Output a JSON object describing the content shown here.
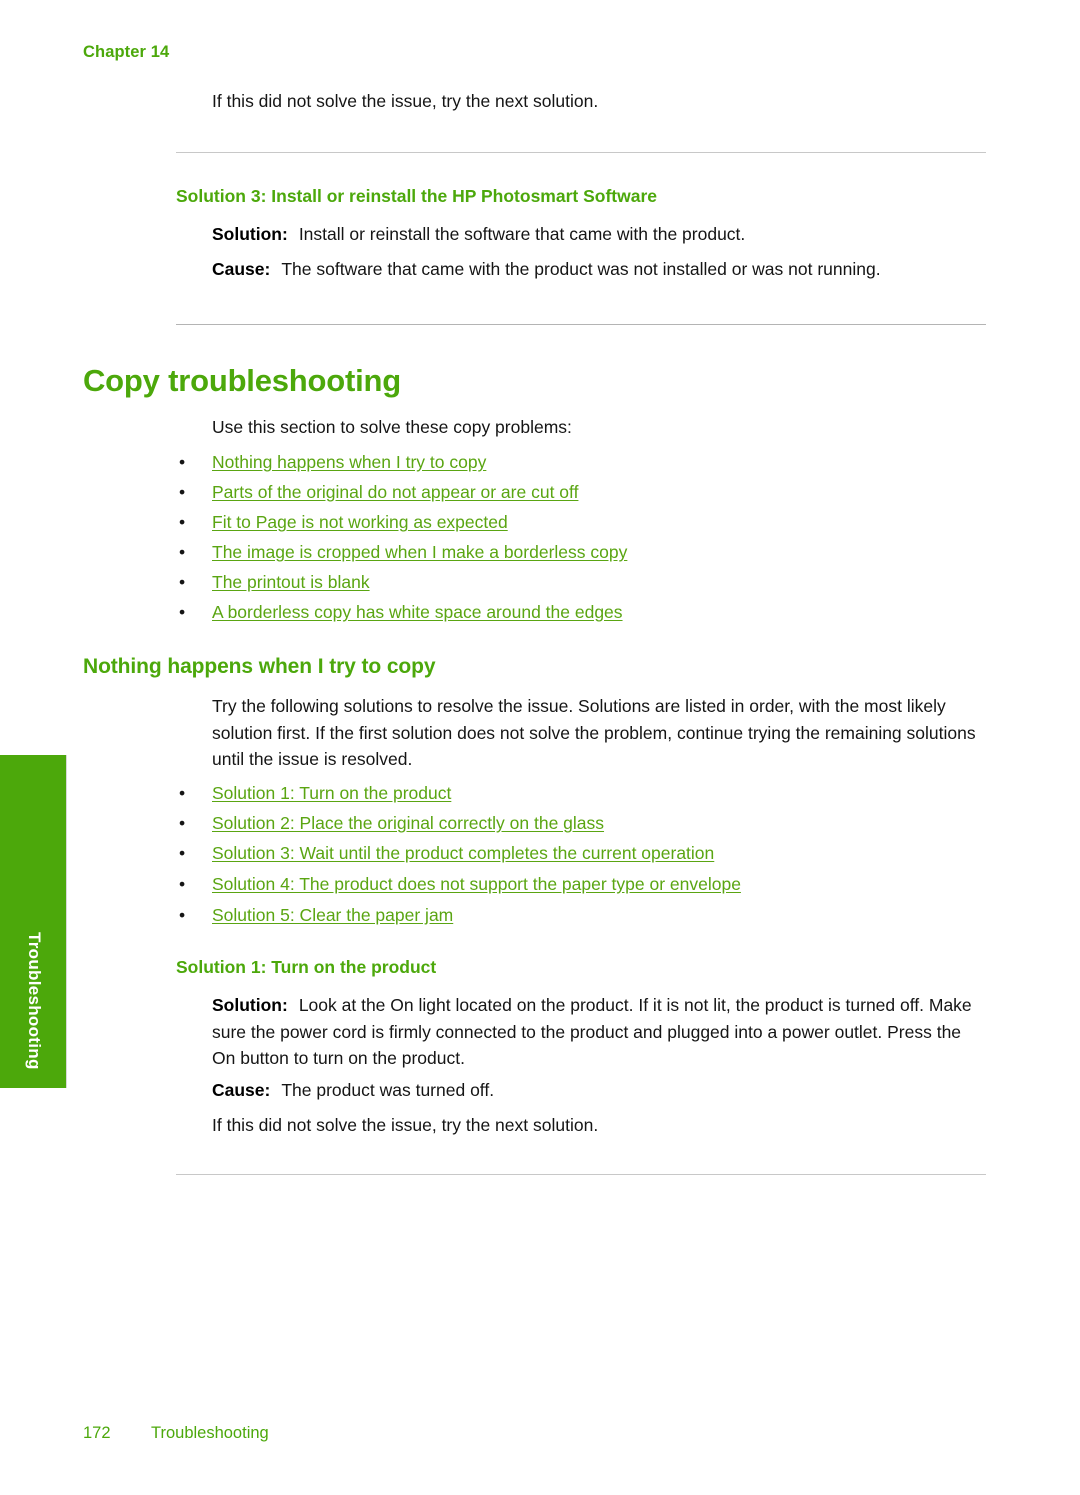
{
  "page": {
    "chapter_label": "Chapter 14",
    "side_tab_label": "Troubleshooting",
    "footer_page_number": "172",
    "footer_section": "Troubleshooting",
    "accent_green": "#4ca80b",
    "link_green": "#5aa512",
    "rule_gray": "#b4b4b4"
  },
  "top_note": "If this did not solve the issue, try the next solution.",
  "solution3": {
    "heading": "Solution 3: Install or reinstall the HP Photosmart Software",
    "solution_label": "Solution:",
    "solution_text": "Install or reinstall the software that came with the product.",
    "cause_label": "Cause:",
    "cause_text": "The software that came with the product was not installed or was not running."
  },
  "copy_troubleshooting": {
    "title": "Copy troubleshooting",
    "intro": "Use this section to solve these copy problems:",
    "links": [
      "Nothing happens when I try to copy",
      "Parts of the original do not appear or are cut off",
      "Fit to Page is not working as expected",
      "The image is cropped when I make a borderless copy",
      "The printout is blank",
      "A borderless copy has white space around the edges"
    ]
  },
  "nothing_happens": {
    "heading": "Nothing happens when I try to copy",
    "intro": "Try the following solutions to resolve the issue. Solutions are listed in order, with the most likely solution first. If the first solution does not solve the problem, continue trying the remaining solutions until the issue is resolved.",
    "links": [
      "Solution 1: Turn on the product",
      "Solution 2: Place the original correctly on the glass",
      "Solution 3: Wait until the product completes the current operation",
      "Solution 4: The product does not support the paper type or envelope",
      "Solution 5: Clear the paper jam"
    ]
  },
  "solution1": {
    "heading": "Solution 1: Turn on the product",
    "solution_label": "Solution:",
    "solution_text": "Look at the On light located on the product. If it is not lit, the product is turned off. Make sure the power cord is firmly connected to the product and plugged into a power outlet. Press the On button to turn on the product.",
    "cause_label": "Cause:",
    "cause_text": "The product was turned off.",
    "next_note": "If this did not solve the issue, try the next solution."
  },
  "bullet_glyph": "•"
}
